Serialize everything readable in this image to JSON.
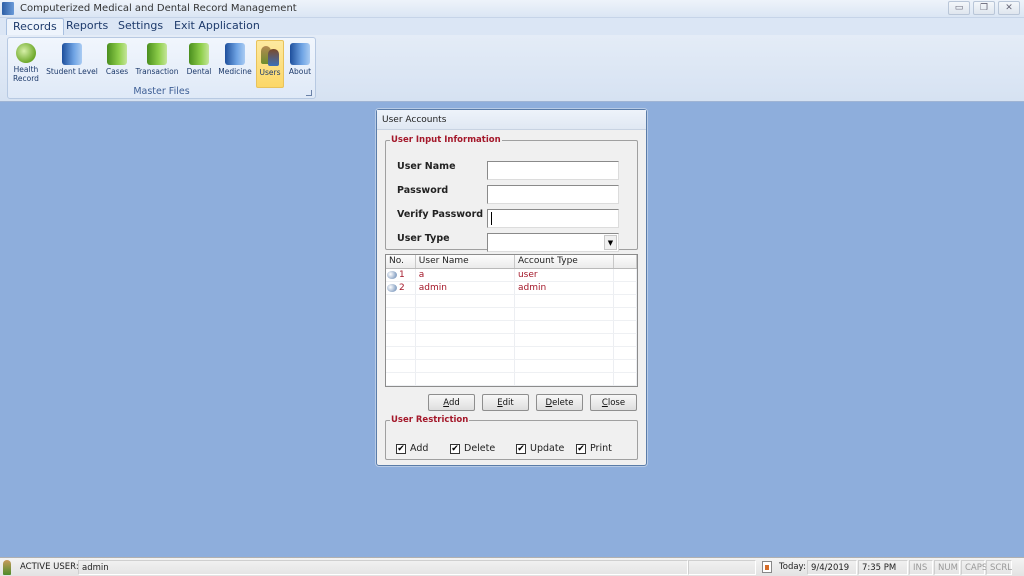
{
  "window": {
    "title": "Computerized Medical and Dental Record Management",
    "controls": [
      "minimize",
      "restore",
      "close"
    ]
  },
  "ribbon": {
    "tabs": [
      {
        "label": "Records",
        "active": true
      },
      {
        "label": "Reports",
        "active": false
      },
      {
        "label": "Settings",
        "active": false
      },
      {
        "label": "Exit Application",
        "active": false
      }
    ],
    "group_label": "Master Files",
    "buttons": [
      {
        "label_line1": "Health",
        "label_line2": "Record",
        "icon": "search-icon"
      },
      {
        "label_line1": "Student Level",
        "label_line2": "",
        "icon": "book-icon"
      },
      {
        "label_line1": "Cases",
        "label_line2": "",
        "icon": "book-icon"
      },
      {
        "label_line1": "Transaction",
        "label_line2": "",
        "icon": "book-icon"
      },
      {
        "label_line1": "Dental",
        "label_line2": "",
        "icon": "book-icon"
      },
      {
        "label_line1": "Medicine",
        "label_line2": "",
        "icon": "book-icon"
      },
      {
        "label_line1": "Users",
        "label_line2": "",
        "icon": "users-icon",
        "active": true
      },
      {
        "label_line1": "About",
        "label_line2": "",
        "icon": "book-icon"
      }
    ]
  },
  "dialog": {
    "title": "User Accounts",
    "input_section": {
      "legend": "User Input Information",
      "fields": [
        {
          "label": "User Name",
          "value": ""
        },
        {
          "label": "Password",
          "value": ""
        },
        {
          "label": "Verify Password",
          "value": ""
        },
        {
          "label": "User Type",
          "value": ""
        }
      ]
    },
    "grid": {
      "columns": [
        "No.",
        "User Name",
        "Account Type"
      ],
      "rows": [
        {
          "no": "1",
          "user_name": "a",
          "account_type": "user"
        },
        {
          "no": "2",
          "user_name": "admin",
          "account_type": "admin"
        }
      ]
    },
    "buttons": {
      "add": {
        "accel": "A",
        "rest": "dd"
      },
      "edit": {
        "accel": "E",
        "rest": "dit"
      },
      "delete": {
        "accel": "D",
        "rest": "elete"
      },
      "close": {
        "accel": "C",
        "rest": "lose"
      }
    },
    "restriction_section": {
      "legend": "User Restriction",
      "checks": [
        {
          "label": "Add",
          "checked": true
        },
        {
          "label": "Delete",
          "checked": true
        },
        {
          "label": "Update",
          "checked": true
        },
        {
          "label": "Print",
          "checked": true
        }
      ]
    }
  },
  "statusbar": {
    "active_user_label": "ACTIVE USER:",
    "active_user": "admin",
    "today_label": "Today:",
    "date": "9/4/2019",
    "time": "7:35 PM",
    "indicators": [
      "INS",
      "NUM",
      "CAPS",
      "SCRL"
    ],
    "check_mark": "✔"
  }
}
